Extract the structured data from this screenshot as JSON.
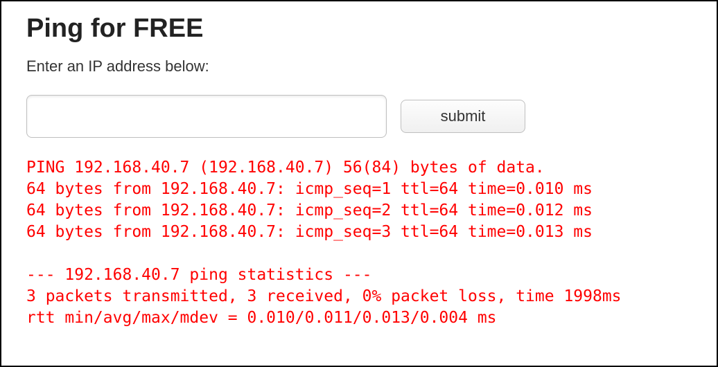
{
  "header": {
    "title": "Ping for FREE"
  },
  "form": {
    "prompt": "Enter an IP address below:",
    "ip_value": "",
    "submit_label": "submit"
  },
  "output": {
    "lines": [
      "PING 192.168.40.7 (192.168.40.7) 56(84) bytes of data.",
      "64 bytes from 192.168.40.7: icmp_seq=1 ttl=64 time=0.010 ms",
      "64 bytes from 192.168.40.7: icmp_seq=2 ttl=64 time=0.012 ms",
      "64 bytes from 192.168.40.7: icmp_seq=3 ttl=64 time=0.013 ms",
      "",
      "--- 192.168.40.7 ping statistics ---",
      "3 packets transmitted, 3 received, 0% packet loss, time 1998ms",
      "rtt min/avg/max/mdev = 0.010/0.011/0.013/0.004 ms"
    ]
  }
}
